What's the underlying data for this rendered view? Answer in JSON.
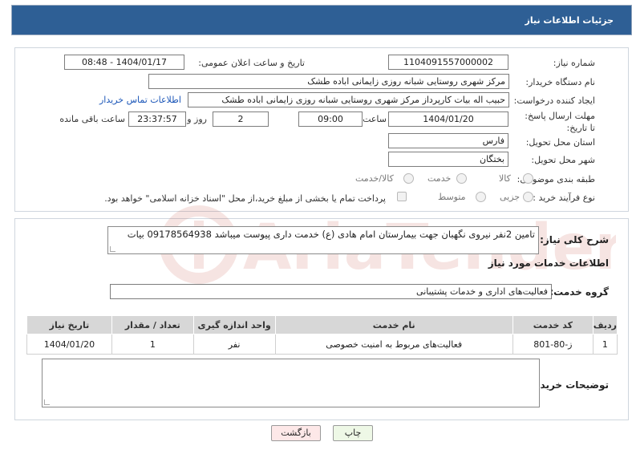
{
  "header": {
    "title": "جزئیات اطلاعات نیاز"
  },
  "form": {
    "need_number_label": "شماره نیاز:",
    "need_number": "1104091557000002",
    "announce_label": "تاریخ و ساعت اعلان عمومی:",
    "announce_value": "1404/01/17 - 08:48",
    "buyer_org_label": "نام دستگاه خریدار:",
    "buyer_org": "مرکز شهری روستایی شبانه روزی زایمانی اباده طشک",
    "requester_label": "ایجاد کننده درخواست:",
    "requester": "حبیب اله بیات کارپرداز مرکز شهری روستایی شبانه روزی زایمانی اباده طشک",
    "contact_link": "اطلاعات تماس خریدار",
    "deadline_label": "مهلت ارسال پاسخ: تا تاریخ:",
    "deadline_date": "1404/01/20",
    "time_label": "ساعت",
    "deadline_time": "09:00",
    "days_value": "2",
    "days_label": "روز و",
    "remaining_time": "23:37:57",
    "remaining_label": "ساعت باقی مانده",
    "province_label": "استان محل تحویل:",
    "province": "فارس",
    "city_label": "شهر محل تحویل:",
    "city": "بختگان",
    "category_label": "طبقه بندی موضوعی:",
    "category_options": [
      "کالا",
      "خدمت",
      "کالا/خدمت"
    ],
    "process_label": "نوع فرآیند خرید :",
    "process_options": [
      "جزیی",
      "متوسط"
    ],
    "payment_note": "پرداخت تمام یا بخشی از مبلغ خرید،از محل \"اسناد خزانه اسلامی\" خواهد بود."
  },
  "details": {
    "summary_label": "شرح کلی نیاز:",
    "summary": "تامین 2نفر نیروی نگهبان جهت بیمارستان امام هادی (ع) خدمت داری پیوست میباشد 09178564938 بیات",
    "services_title": "اطلاعات خدمات مورد نیاز",
    "group_label": "گروه خدمت:",
    "group_value": "فعالیت‌های اداری و خدمات پشتیبانی",
    "table": {
      "headers": [
        "ردیف",
        "کد خدمت",
        "نام خدمت",
        "واحد اندازه گیری",
        "تعداد / مقدار",
        "تاریخ نیاز"
      ],
      "rows": [
        [
          "1",
          "ز-80-801",
          "فعالیت‌های مربوط به امنیت خصوصی",
          "نفر",
          "1",
          "1404/01/20"
        ]
      ]
    },
    "buyer_notes_label": "توضیحات خریدار:",
    "buyer_notes": ""
  },
  "buttons": {
    "print": "چاپ",
    "back": "بازگشت"
  },
  "watermark": {
    "text": "AriaTender.neT"
  },
  "colors": {
    "header_bg": "#2e5f95",
    "link": "#1b56b8",
    "watermark": "#c0392b"
  }
}
